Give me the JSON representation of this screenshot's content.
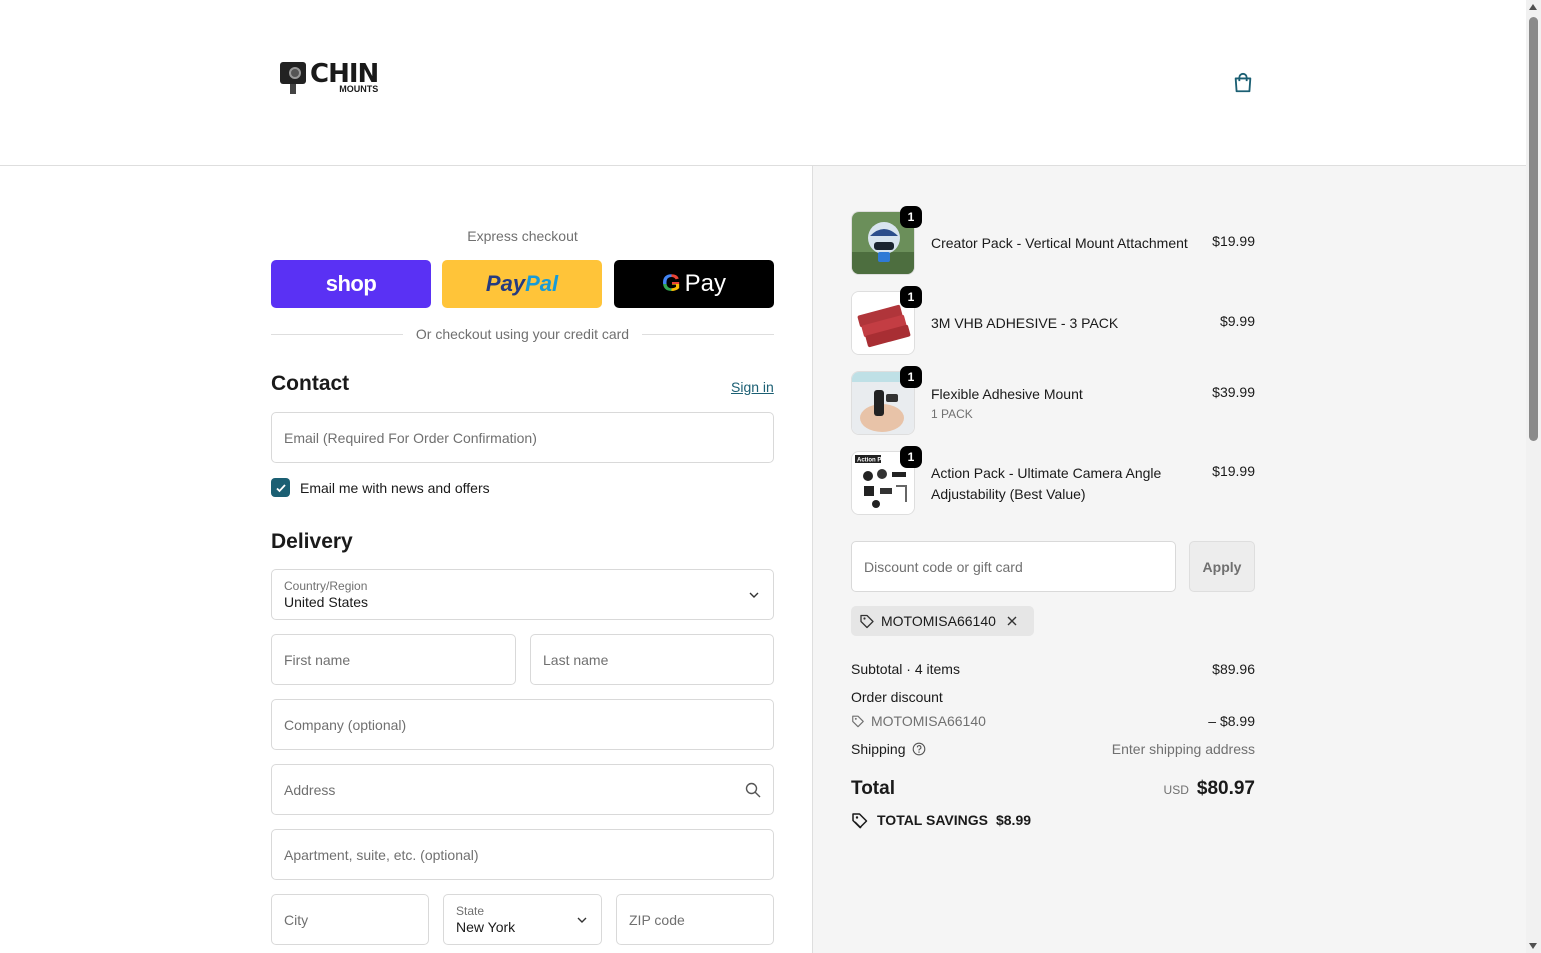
{
  "header": {
    "logo_text": "CHIN",
    "logo_sub": "MOUNTS",
    "cart_icon": "shopping-bag-icon"
  },
  "express": {
    "label": "Express checkout",
    "shop_label": "shop",
    "paypal_label_1": "Pay",
    "paypal_label_2": "Pal",
    "gpay_g": "G",
    "gpay_label": "Pay",
    "divider_text": "Or checkout using your credit card"
  },
  "contact": {
    "title": "Contact",
    "sign_in": "Sign in",
    "email_placeholder": "Email (Required For Order Confirmation)",
    "newsletter_label": "Email me with news and offers",
    "newsletter_checked": true
  },
  "delivery": {
    "title": "Delivery",
    "country_label": "Country/Region",
    "country_value": "United States",
    "first_name": "First name",
    "last_name": "Last name",
    "company": "Company (optional)",
    "address": "Address",
    "apartment": "Apartment, suite, etc. (optional)",
    "city": "City",
    "state_label": "State",
    "state_value": "New York",
    "zip": "ZIP code"
  },
  "cart": {
    "items": [
      {
        "name": "Creator Pack - Vertical Mount Attachment",
        "sub": "",
        "price": "$19.99",
        "qty": "1"
      },
      {
        "name": "3M VHB ADHESIVE - 3 PACK",
        "sub": "",
        "price": "$9.99",
        "qty": "1"
      },
      {
        "name": "Flexible Adhesive Mount",
        "sub": "1 PACK",
        "price": "$39.99",
        "qty": "1"
      },
      {
        "name": "Action Pack - Ultimate Camera Angle Adjustability (Best Value)",
        "sub": "",
        "price": "$19.99",
        "qty": "1"
      }
    ],
    "thumb_4_label": "Action Pack"
  },
  "discount": {
    "placeholder": "Discount code or gift card",
    "apply": "Apply",
    "code": "MOTOMISA66140"
  },
  "summary": {
    "subtotal_label": "Subtotal · 4 items",
    "subtotal_value": "$89.96",
    "order_discount_label": "Order discount",
    "discount_code": "MOTOMISA66140",
    "discount_value": "– $8.99",
    "shipping_label": "Shipping",
    "shipping_value": "Enter shipping address",
    "total_label": "Total",
    "total_currency": "USD",
    "total_value": "$80.97",
    "savings_label": "TOTAL SAVINGS",
    "savings_value": "$8.99"
  },
  "colors": {
    "accent": "#1b5f73",
    "shop": "#5a31f4",
    "paypal": "#ffc439"
  }
}
